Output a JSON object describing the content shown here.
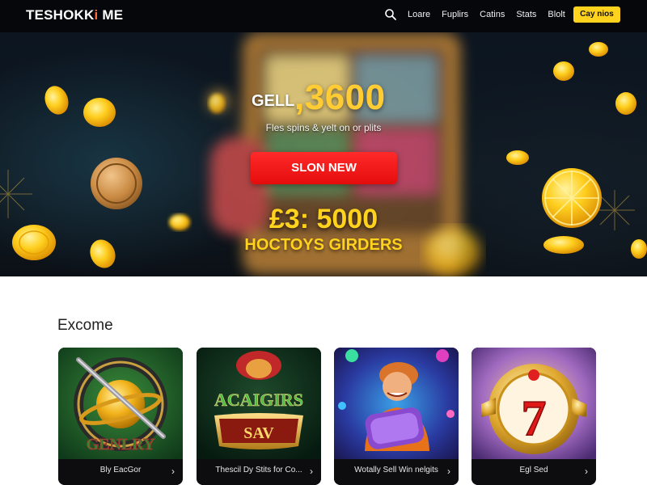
{
  "header": {
    "logo_main": "TESHOKK",
    "logo_accent": "i",
    "logo_end": " ME",
    "search_icon": "search-icon",
    "nav": [
      "Loare",
      "Fuplirs",
      "Catins",
      "Stats",
      "Blolt"
    ],
    "cta_label": "Cay nios"
  },
  "hero": {
    "pretitle": "GELL",
    "amount": ",3600",
    "subtitle": "Fles spins & yelt on or plits",
    "button_label": "SLON NEW",
    "bonus": "£3: 5000",
    "bonus_sub": "HOCTOYS GIRDERS",
    "accent_color": "#ffd21e",
    "button_color": "#ff1a1a"
  },
  "section": {
    "title": "Excome",
    "games": [
      {
        "title": "Bly EacGor",
        "art_text": "GENLRY",
        "icon": "saturn-planet-icon"
      },
      {
        "title": "Thescil Dy Stits for Co...",
        "art_text": "ACAIGIRS",
        "art_text2": "SAV",
        "icon": "treasure-chest-icon"
      },
      {
        "title": "Wotally Sell Win nelgits",
        "art_text": "",
        "icon": "character-icon"
      },
      {
        "title": "Egl Sed",
        "art_text": "7",
        "icon": "lucky-seven-icon"
      }
    ]
  }
}
